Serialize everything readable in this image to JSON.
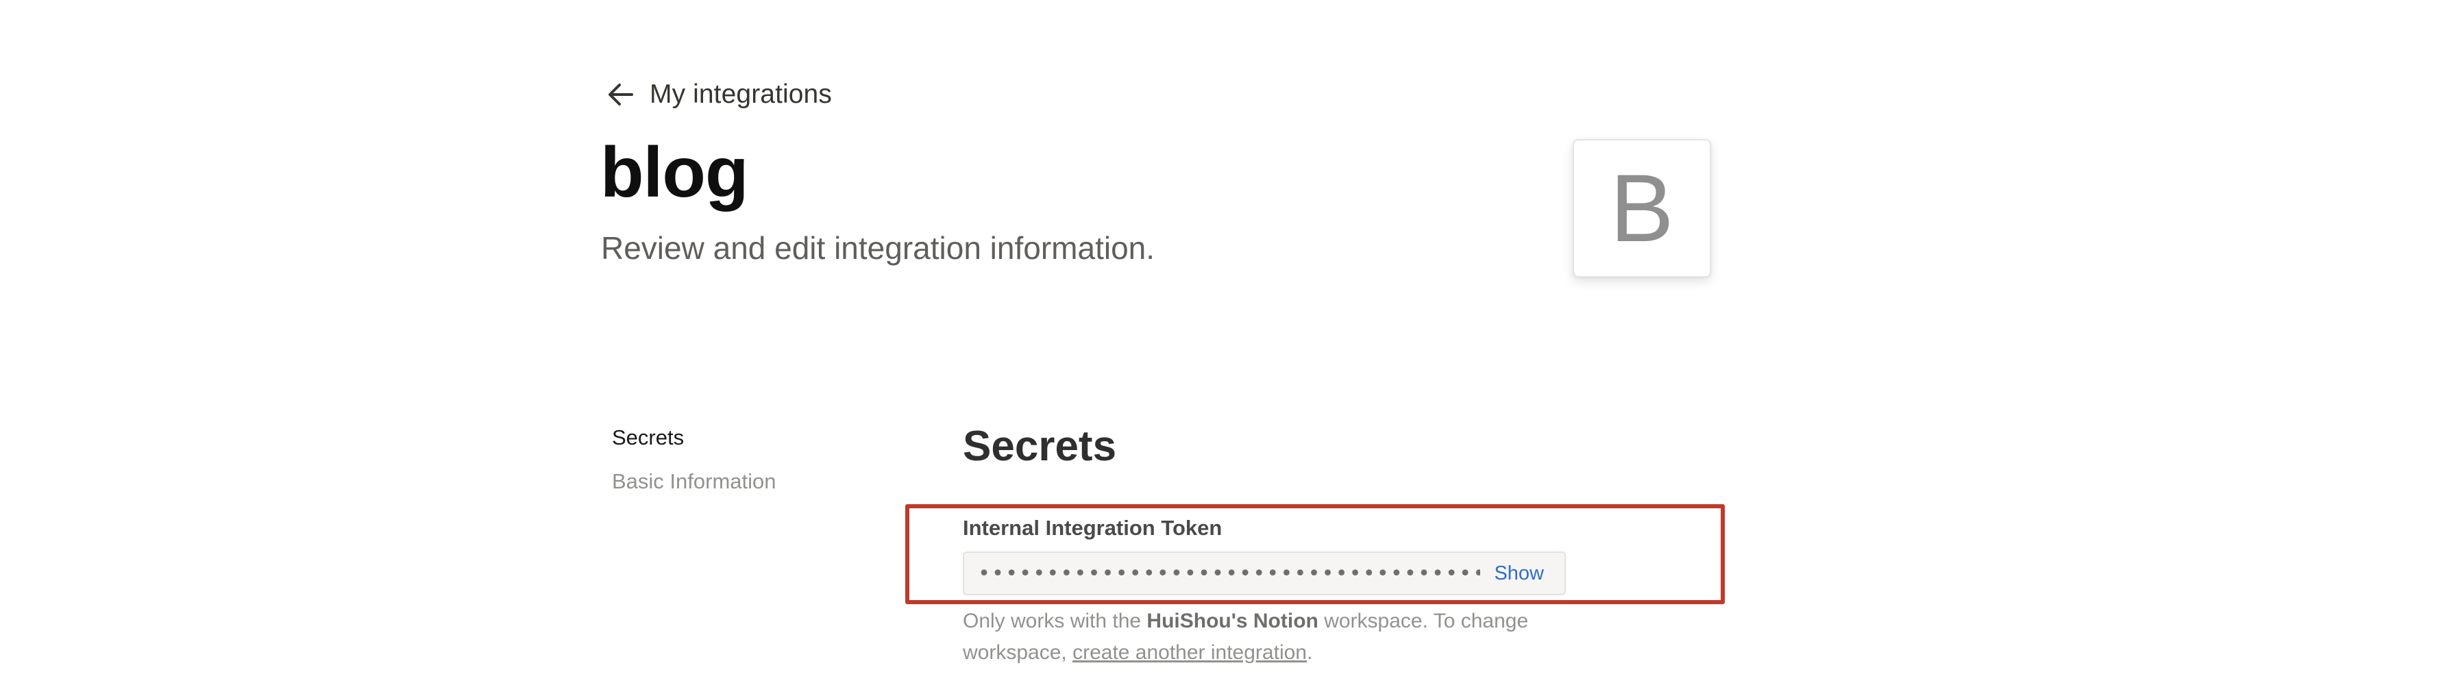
{
  "header": {
    "back_label": "My integrations",
    "title": "blog",
    "subtitle": "Review and edit integration information."
  },
  "logo": {
    "letter": "B"
  },
  "side_nav": {
    "items": [
      {
        "label": "Secrets",
        "active": true
      },
      {
        "label": "Basic Information",
        "active": false
      }
    ]
  },
  "secrets": {
    "heading": "Secrets",
    "token_label": "Internal Integration Token",
    "token_masked": "••••••••••••••••••••••••••••••••••••••••",
    "show_label": "Show",
    "help_prefix": "Only works with the ",
    "help_workspace": "HuiShou's Notion",
    "help_middle": " workspace. To change workspace, ",
    "help_link": "create another integration",
    "help_suffix": "."
  },
  "colors": {
    "highlight_border": "#c0392b",
    "link_blue": "#2f6fc6"
  },
  "icons": {
    "back": "arrow-left-icon"
  }
}
